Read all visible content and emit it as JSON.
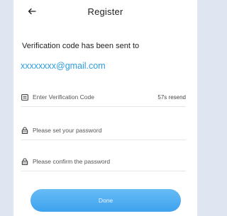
{
  "header": {
    "back_glyph": "←",
    "title": "Register"
  },
  "info": {
    "sent_text": "Verification code has been sent to",
    "email": "xxxxxxxx@gmail.com"
  },
  "fields": {
    "code": {
      "placeholder": "Enter Verification Code",
      "resend": "57s resend",
      "icon": "message-icon"
    },
    "password": {
      "placeholder": "Please set your password",
      "icon": "lock-icon"
    },
    "confirm": {
      "placeholder": "Please confirm the password",
      "icon": "lock-icon"
    }
  },
  "done_label": "Done",
  "colors": {
    "accent": "#3ea2ee",
    "email": "#2a9de0"
  }
}
